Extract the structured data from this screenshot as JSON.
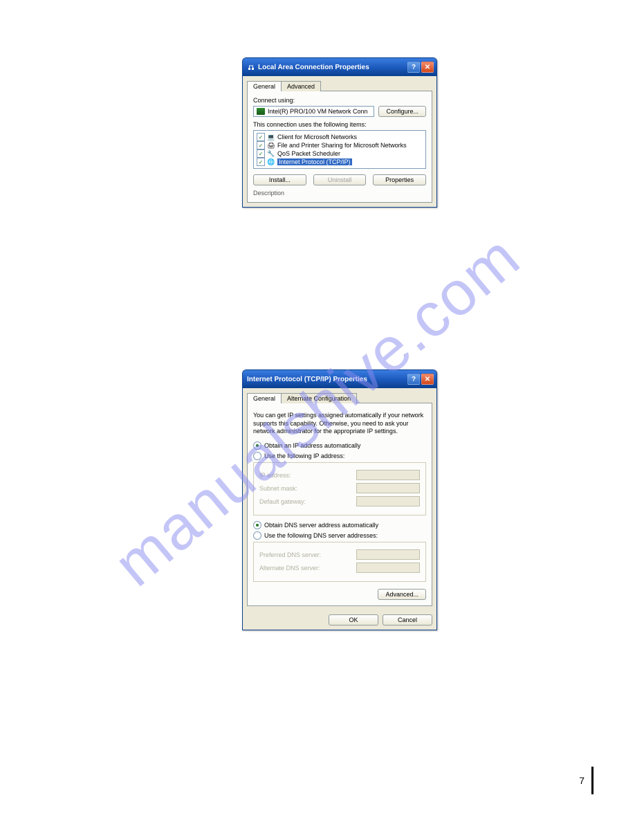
{
  "watermark": "manualshive.com",
  "dialog1": {
    "title": "Local Area Connection Properties",
    "tabs": {
      "general": "General",
      "advanced": "Advanced"
    },
    "connect_using_label": "Connect using:",
    "adapter": "Intel(R) PRO/100 VM Network Conn",
    "configure_btn": "Configure...",
    "items_label": "This connection uses the following items:",
    "items": [
      {
        "label": "Client for Microsoft Networks"
      },
      {
        "label": "File and Printer Sharing for Microsoft Networks"
      },
      {
        "label": "QoS Packet Scheduler"
      },
      {
        "label": "Internet Protocol (TCP/IP)"
      }
    ],
    "install_btn": "Install...",
    "uninstall_btn": "Uninstall",
    "properties_btn": "Properties",
    "description_label": "Description"
  },
  "dialog2": {
    "title": "Internet Protocol (TCP/IP) Properties",
    "tabs": {
      "general": "General",
      "alt": "Alternate Configuration"
    },
    "desc": "You can get IP settings assigned automatically if your network supports this capability. Otherwise, you need to ask your network administrator for the appropriate IP settings.",
    "radio_auto_ip": "Obtain an IP address automatically",
    "radio_use_ip": "Use the following IP address:",
    "ip_address": "IP address:",
    "subnet": "Subnet mask:",
    "gateway": "Default gateway:",
    "radio_auto_dns": "Obtain DNS server address automatically",
    "radio_use_dns": "Use the following DNS server addresses:",
    "pref_dns": "Preferred DNS server:",
    "alt_dns": "Alternate DNS server:",
    "advanced_btn": "Advanced...",
    "ok_btn": "OK",
    "cancel_btn": "Cancel"
  },
  "page_number": "7"
}
